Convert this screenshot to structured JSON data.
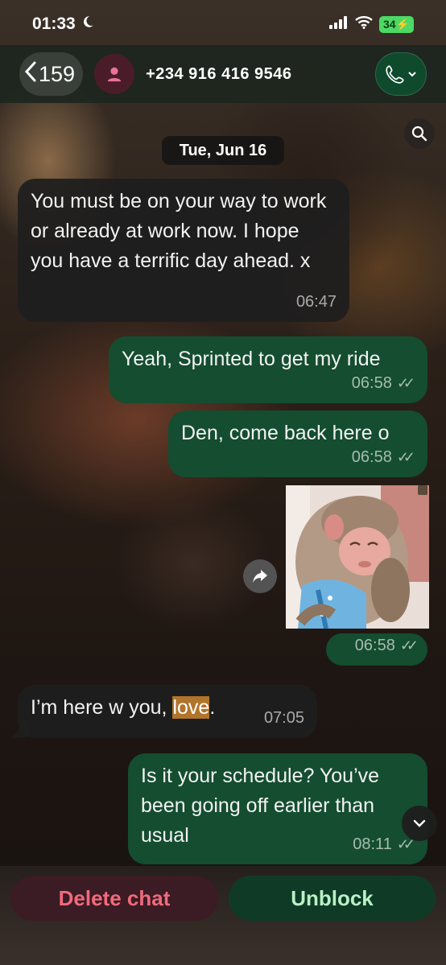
{
  "status_bar": {
    "time": "01:33",
    "battery": "34"
  },
  "header": {
    "back_count": "159",
    "contact": "+234 916 416 9546"
  },
  "date_separator": "Tue, Jun 16",
  "messages": [
    {
      "direction": "incoming",
      "text": "You must be on your way to work or already at work now. I hope you have a terrific day ahead. x",
      "time": "06:47"
    },
    {
      "direction": "outgoing",
      "text": "Yeah, Sprinted to get my ride",
      "time": "06:58"
    },
    {
      "direction": "outgoing",
      "text": "Den, come back here o",
      "time": "06:58"
    },
    {
      "direction": "outgoing",
      "type": "sticker",
      "sticker": "sad-monkey-sticker",
      "time": "06:58"
    },
    {
      "direction": "incoming",
      "text_before": "I’m here w you, ",
      "text_highlight": "love",
      "text_after": ".",
      "time": "07:05"
    },
    {
      "direction": "outgoing",
      "text": "Is it your schedule? You’ve been going off earlier than usual",
      "time": "08:11"
    }
  ],
  "actions": {
    "delete": "Delete chat",
    "unblock": "Unblock"
  },
  "colors": {
    "outgoing_bubble": "#144d2f",
    "incoming_bubble": "#1e1e1e",
    "delete_text": "#f06a7c",
    "unblock_text": "#b9f0c6"
  }
}
